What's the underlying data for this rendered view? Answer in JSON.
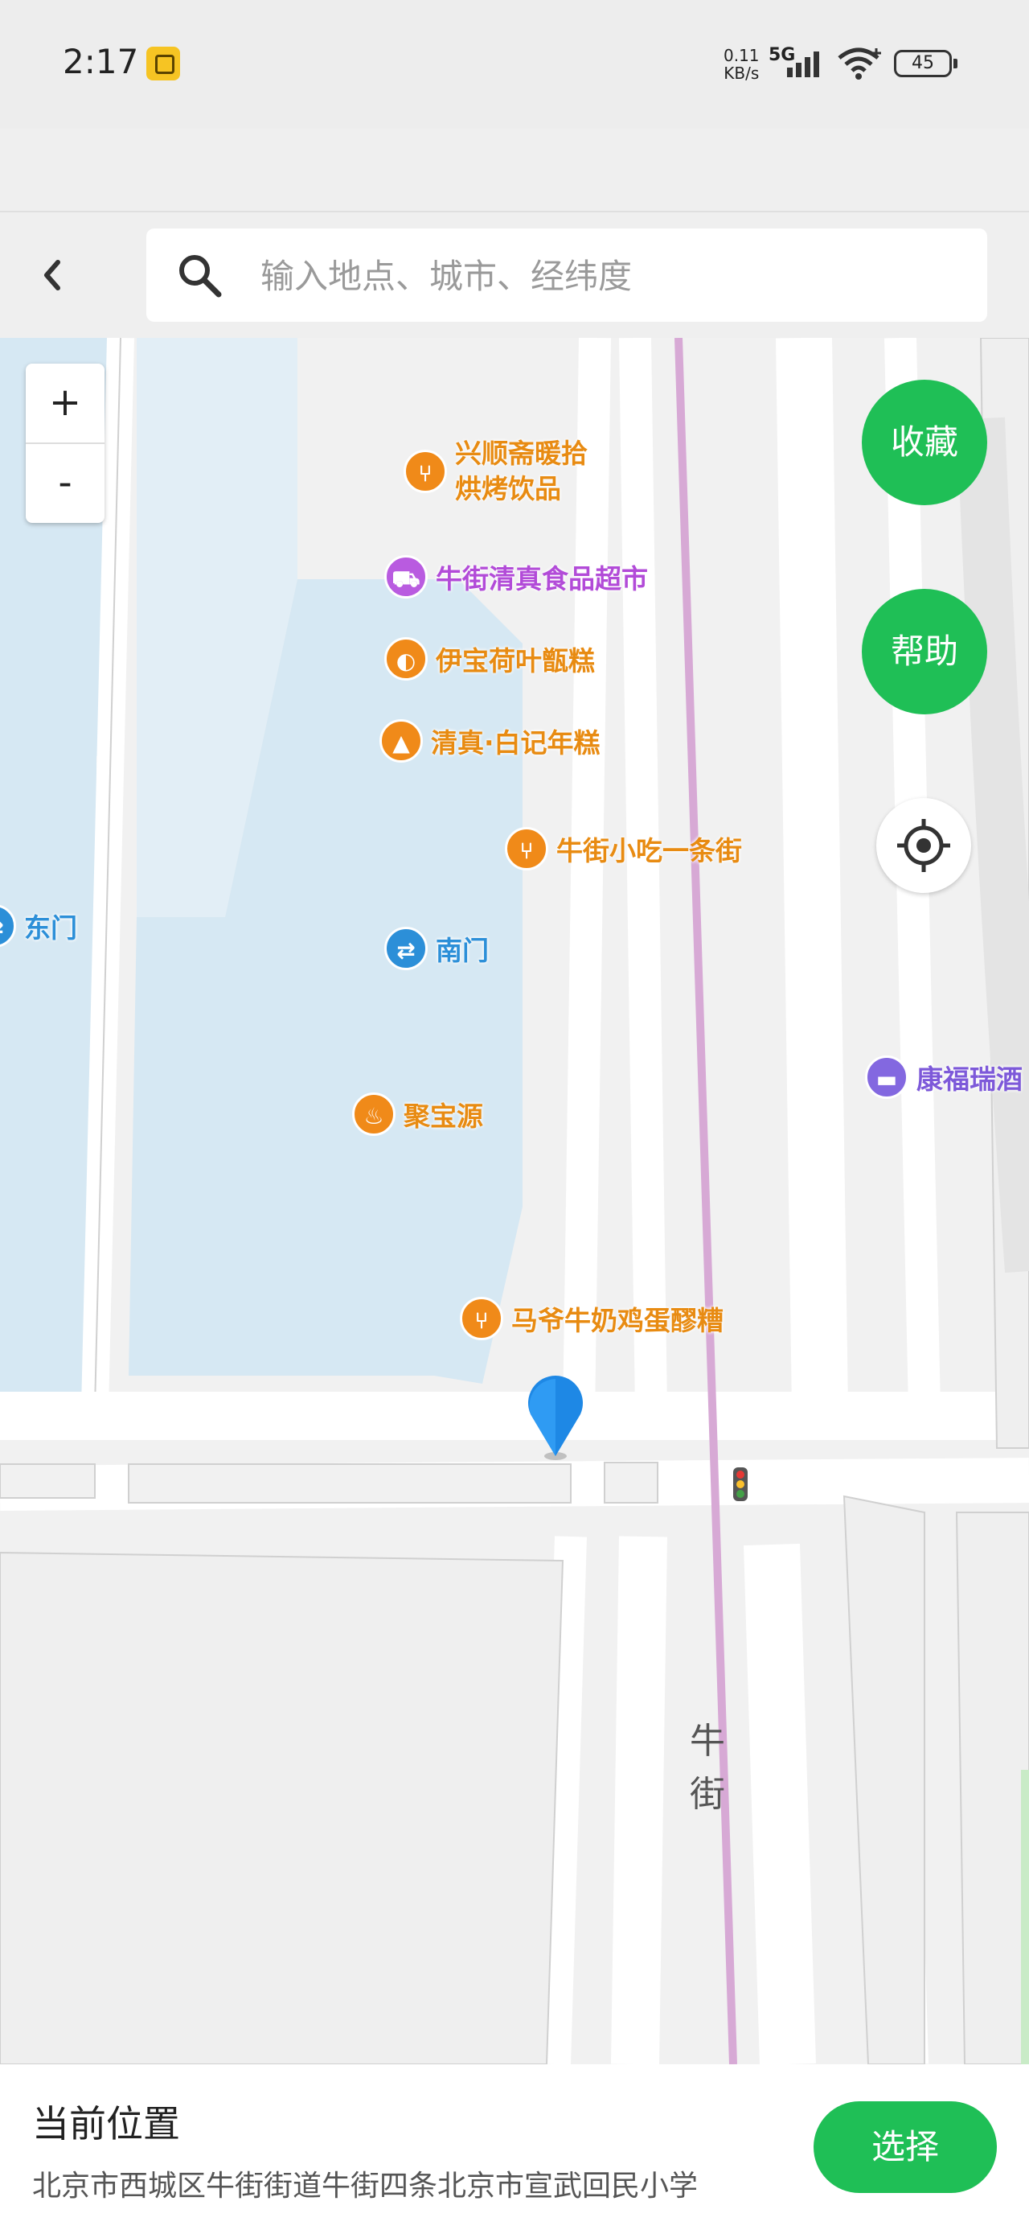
{
  "status_bar": {
    "time": "2:17",
    "net_speed_value": "0.11",
    "net_speed_unit": "KB/s",
    "network": "5G",
    "battery": "45"
  },
  "header": {
    "search_placeholder": "输入地点、城市、经纬度"
  },
  "map": {
    "zoom_in": "+",
    "zoom_out": "-",
    "favorite_button": "收藏",
    "help_button": "帮助",
    "street_name": "牛街",
    "pois": [
      {
        "line1": "兴顺斋暖拾",
        "line2": "烘烤饮品",
        "icon": "restaurant-icon",
        "color": "#f08a19"
      },
      {
        "line1": "牛街清真食品超市",
        "icon": "shopping-cart-icon",
        "color": "#b95be0"
      },
      {
        "line1": "伊宝荷叶甑糕",
        "icon": "snack-icon",
        "color": "#f08a19"
      },
      {
        "line1": "清真·白记年糕",
        "icon": "dessert-icon",
        "color": "#f08a19"
      },
      {
        "line1": "牛街小吃一条街",
        "icon": "restaurant-icon",
        "color": "#f08a19"
      },
      {
        "line1": "东门",
        "icon": "entrance-icon",
        "color": "#2c8fd8"
      },
      {
        "line1": "南门",
        "icon": "entrance-icon",
        "color": "#2c8fd8"
      },
      {
        "line1": "康福瑞酒",
        "icon": "hotel-icon",
        "color": "#8368e0"
      },
      {
        "line1": "聚宝源",
        "icon": "hotpot-icon",
        "color": "#f08a19"
      },
      {
        "line1": "马爷牛奶鸡蛋醪糟",
        "icon": "restaurant-icon",
        "color": "#f08a19"
      }
    ]
  },
  "bottom_panel": {
    "title": "当前位置",
    "address": "北京市西城区牛街街道牛街四条北京市宣武回民小学",
    "select_button": "选择"
  },
  "colors": {
    "accent_green": "#1fbf56",
    "marker_blue": "#1e88e5",
    "water": "#d6e8f3",
    "rail": "#d7a9d5"
  }
}
